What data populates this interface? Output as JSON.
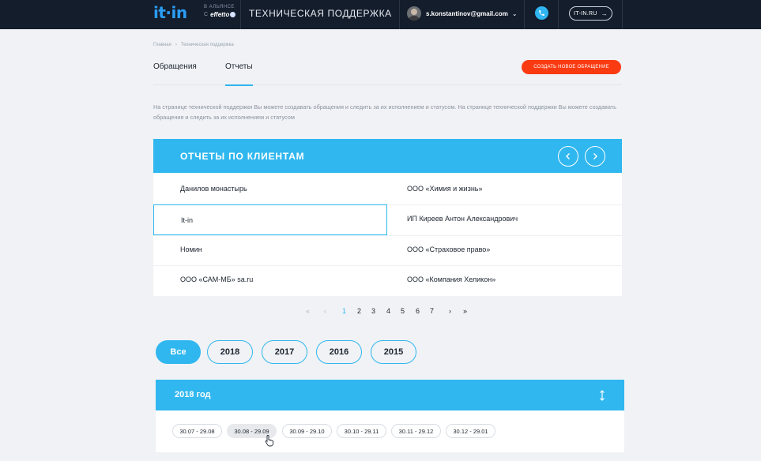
{
  "header": {
    "logo": "it·in",
    "alliance_line1": "В АЛЬЯНСЕ",
    "alliance_c": "С",
    "alliance_brand": "effetto",
    "title": "ТЕХНИЧЕСКАЯ ПОДДЕРЖКА",
    "user_email": "s.konstantinov@gmail.com",
    "site_link": "IT-IN.RU",
    "accent_color": "#2fb5ef",
    "bg_color": "#141d2c"
  },
  "breadcrumb": [
    "Главная",
    "Техническая поддержка"
  ],
  "tabs": [
    {
      "label": "Обращения",
      "active": false
    },
    {
      "label": "Отчеты",
      "active": true
    }
  ],
  "create_button": "СОЗДАТЬ НОВОЕ ОБРАЩЕНИЕ",
  "description": "На странице технической поддержки Вы можете создавать обращения и следить за их исполнением и статусом. На странице технической поддержки Вы можете создавать обращения и следить за их исполнением и статусом",
  "clients_panel": {
    "title": "ОТЧЕТЫ ПО КЛИЕНТАМ",
    "clients_left": [
      "Данилов монастырь",
      "It-in",
      "Номин",
      "ООО «САМ-МБ» sa.ru"
    ],
    "clients_right": [
      "ООО «Химия и жизнь»",
      "ИП Киреев Антон Александрович",
      "ООО «Страховое право»",
      "ООО «Компания Хеликон»"
    ],
    "selected": "It-in"
  },
  "pagination": {
    "first": "«",
    "prev": "‹",
    "pages": [
      "1",
      "2",
      "3",
      "4",
      "5",
      "6",
      "7"
    ],
    "current": "1",
    "next": "›",
    "last": "»"
  },
  "year_filter": {
    "options": [
      "Все",
      "2018",
      "2017",
      "2016",
      "2015"
    ],
    "active": "Все"
  },
  "year_panel": {
    "title": "2018 год",
    "periods": [
      "30.07 - 29.08",
      "30.08 - 29.09",
      "30.09 - 29.10",
      "30.10 - 29.11",
      "30.11 - 29.12",
      "30.12 - 29.01"
    ],
    "hovered": "30.08 - 29.09"
  }
}
